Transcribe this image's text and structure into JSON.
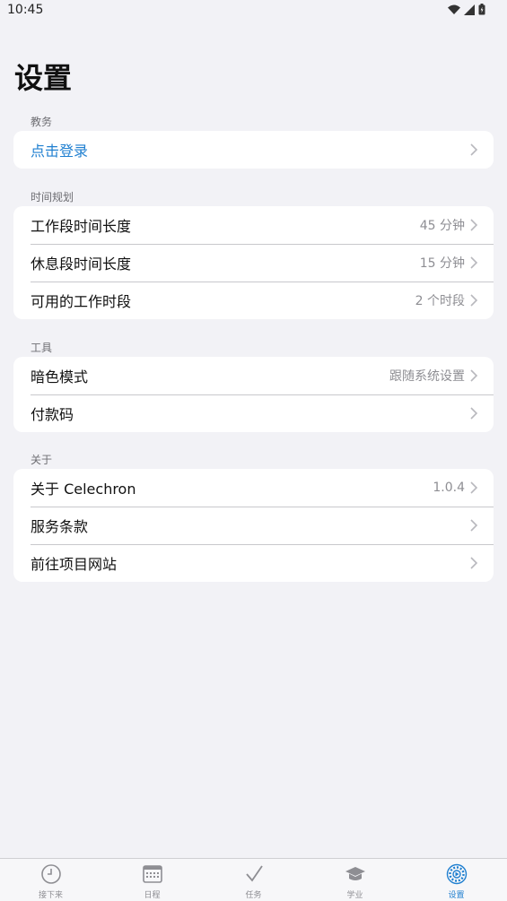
{
  "status_bar": {
    "time": "10:45",
    "icons": [
      "wifi-icon",
      "signal-icon",
      "battery-icon"
    ]
  },
  "page_title": "设置",
  "colors": {
    "accent": "#1f7fd0",
    "background": "#f2f2f6",
    "card": "#ffffff",
    "secondary_text": "#8e8e93"
  },
  "sections": {
    "academic": {
      "header": "教务",
      "rows": [
        {
          "label": "点击登录",
          "value": "",
          "icon": "chevron-right-icon"
        }
      ]
    },
    "time_planning": {
      "header": "时间规划",
      "rows": [
        {
          "label": "工作段时间长度",
          "value": "45 分钟",
          "icon": "chevron-right-icon"
        },
        {
          "label": "休息段时间长度",
          "value": "15 分钟",
          "icon": "chevron-right-icon"
        },
        {
          "label": "可用的工作时段",
          "value": "2 个时段",
          "icon": "chevron-right-icon"
        }
      ]
    },
    "tools": {
      "header": "工具",
      "rows": [
        {
          "label": "暗色模式",
          "value": "跟随系统设置",
          "icon": "chevron-right-icon"
        },
        {
          "label": "付款码",
          "value": "",
          "icon": "chevron-right-icon"
        }
      ]
    },
    "about": {
      "header": "关于",
      "rows": [
        {
          "label": "关于 Celechron",
          "value": "1.0.4",
          "icon": "chevron-right-icon"
        },
        {
          "label": "服务条款",
          "value": "",
          "icon": "chevron-right-icon"
        },
        {
          "label": "前往项目网站",
          "value": "",
          "icon": "chevron-right-icon"
        }
      ]
    }
  },
  "tab_bar": {
    "active": "设置",
    "tabs": [
      {
        "label": "接下来",
        "icon": "clock-icon"
      },
      {
        "label": "日程",
        "icon": "calendar-icon"
      },
      {
        "label": "任务",
        "icon": "checkmark-icon"
      },
      {
        "label": "学业",
        "icon": "graduation-cap-icon"
      },
      {
        "label": "设置",
        "icon": "settings-icon"
      }
    ]
  }
}
